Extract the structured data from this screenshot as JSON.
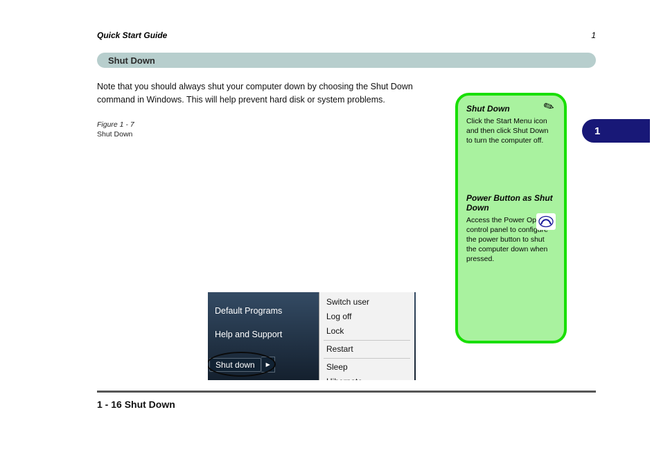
{
  "header": {
    "chapter": "Quick Start Guide",
    "section_number": "1"
  },
  "title_bar": "Shut Down",
  "body": "Note that you should always shut your computer down by choosing the Shut Down command in Windows. This will help prevent hard disk or system problems.",
  "figure": {
    "label": "Figure 1 - 7",
    "caption": "Shut Down",
    "left_panel": {
      "default_programs": "Default Programs",
      "help_support": "Help and Support"
    },
    "shutdown_button": {
      "label": "Shut down",
      "arrow": "▶"
    },
    "menu_items": [
      "Switch user",
      "Log off",
      "Lock",
      "Restart",
      "Sleep",
      "Hibernate"
    ]
  },
  "sidebar": {
    "block1_title": "Shut Down",
    "block1_text": "Click the Start Menu icon and then click Shut Down to turn the computer off.",
    "block2_title": "Power Button as Shut Down",
    "block2_text": "Access the Power Options control panel to configure the power button to shut the computer down when pressed."
  },
  "page_tab": "1",
  "page_number": "1 - 16 Shut Down"
}
